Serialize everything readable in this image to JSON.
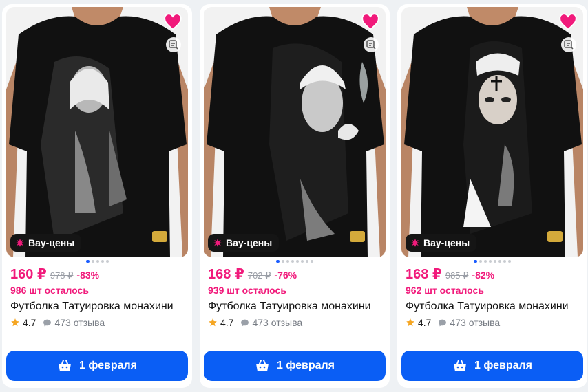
{
  "colors": {
    "accent": "#f11a7b",
    "primary": "#0a5ef5",
    "badge_bg": "#151515"
  },
  "products": [
    {
      "badge": "Вау-цены",
      "price": "160 ₽",
      "old_price": "978 ₽",
      "discount": "-83%",
      "stock": "986 шт осталось",
      "title": "Футболка Татуировка монахини",
      "rating": "4.7",
      "reviews": "473 отзыва",
      "delivery": "1 февраля",
      "image": "black-tshirt-nun-print-praying",
      "favorited": true
    },
    {
      "badge": "Вау-цены",
      "price": "168 ₽",
      "old_price": "702 ₽",
      "discount": "-76%",
      "stock": "939 шт осталось",
      "title": "Футболка Татуировка монахини",
      "rating": "4.7",
      "reviews": "473 отзыва",
      "delivery": "1 февраля",
      "image": "black-tshirt-nun-print-smoke",
      "favorited": true
    },
    {
      "badge": "Вау-цены",
      "price": "168 ₽",
      "old_price": "985 ₽",
      "discount": "-82%",
      "stock": "962 шт осталось",
      "title": "Футболка Татуировка монахини",
      "rating": "4.7",
      "reviews": "473 отзыва",
      "delivery": "1 февраля",
      "image": "black-tshirt-nun-print-cigarette",
      "favorited": true
    }
  ]
}
